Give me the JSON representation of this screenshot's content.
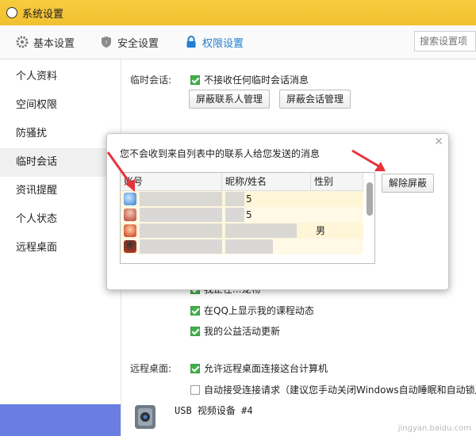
{
  "window": {
    "title": "系统设置"
  },
  "tabs": [
    {
      "label": "基本设置",
      "icon": "gear-icon"
    },
    {
      "label": "安全设置",
      "icon": "shield-icon"
    },
    {
      "label": "权限设置",
      "icon": "lock-icon",
      "active": true
    }
  ],
  "search": {
    "placeholder": "搜索设置项"
  },
  "sidebar": {
    "items": [
      {
        "label": "个人资料"
      },
      {
        "label": "空间权限"
      },
      {
        "label": "防骚扰"
      },
      {
        "label": "临时会话",
        "active": true
      },
      {
        "label": "资讯提醒"
      },
      {
        "label": "个人状态"
      },
      {
        "label": "远程桌面"
      }
    ]
  },
  "temp_session": {
    "label": "临时会话:",
    "checkbox": "不接收任何临时会话消息",
    "btn_contacts": "屏蔽联系人管理",
    "btn_sessions": "屏蔽会话管理"
  },
  "news": {
    "item_partial": "我正在...宠物",
    "item2": "在QQ上显示我的课程动态",
    "item3": "我的公益活动更新"
  },
  "remote": {
    "label": "远程桌面:",
    "item1": "允许远程桌面连接这台计算机",
    "item2": "自动接受连接请求（建议您手动关闭Windows自动睡眠和自动锁屏"
  },
  "device": {
    "label": "USB 视频设备 #4"
  },
  "dialog": {
    "message": "您不会收到来自列表中的联系人给您发送的消息",
    "columns": [
      "账号",
      "昵称/姓名",
      "性别"
    ],
    "rows": [
      {
        "nick_tail": "5",
        "gender": ""
      },
      {
        "nick_tail": "5",
        "gender": ""
      },
      {
        "nick_tail": "",
        "gender": "男"
      },
      {
        "nick_tail": "",
        "gender": ""
      }
    ],
    "unblock_button": "解除屏蔽"
  },
  "watermark": "jingyan.baidu.com",
  "colors": {
    "accent": "#1f7fd0",
    "titlebar": "#f0c030",
    "check": "#42b04a",
    "arrow": "#e8333a"
  }
}
